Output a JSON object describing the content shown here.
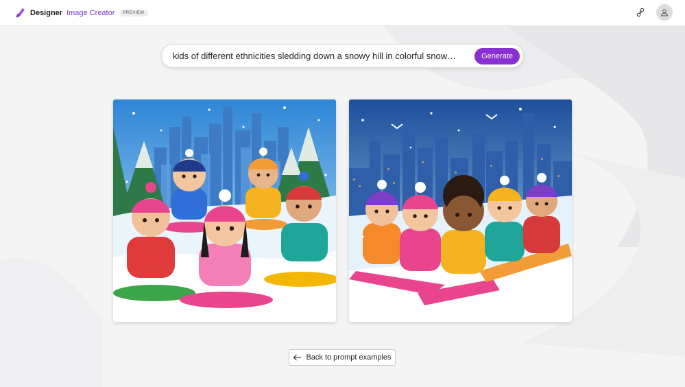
{
  "header": {
    "brand_name": "Designer",
    "product_name": "Image Creator",
    "badge": "PREVIEW",
    "logo_icon": "designer-logo-icon",
    "share_icon": "share-icon",
    "avatar_icon": "person-icon"
  },
  "prompt": {
    "value": "kids of different ethnicities sledding down a snowy hill in colorful snow…",
    "generate_label": "Generate"
  },
  "results": {
    "images": [
      {
        "subject": "cartoon children on sleds in snowy city park"
      },
      {
        "subject": "cartoon children sledding in a row before city skyline"
      }
    ]
  },
  "footer": {
    "back_label": "Back to prompt examples",
    "back_icon": "arrow-left-icon"
  },
  "colors": {
    "accent": "#8a2fd1",
    "product_text": "#7d36c7",
    "background": "#f5f5f6"
  }
}
